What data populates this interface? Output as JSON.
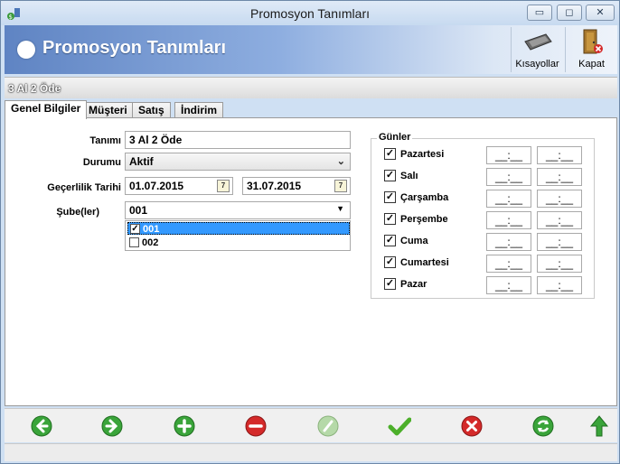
{
  "window": {
    "title": "Promosyon Tanımları",
    "minimize_glyph": "▭",
    "maximize_glyph": "◻",
    "close_glyph": "✕"
  },
  "banner": {
    "title": "Promosyon Tanımları",
    "shortcuts_label": "Kısayollar",
    "close_label": "Kapat"
  },
  "record_title": "3 Al 2 Öde",
  "tabs": [
    {
      "label": "Genel Bilgiler",
      "active": true
    },
    {
      "label": "Müşteri",
      "active": false
    },
    {
      "label": "Satış",
      "active": false
    },
    {
      "label": "İndirim",
      "active": false
    }
  ],
  "form": {
    "name_label": "Tanımı",
    "name_value": "3 Al 2 Öde",
    "status_label": "Durumu",
    "status_value": "Aktif",
    "validity_label": "Geçerlilik Tarihi",
    "date_start": "01.07.2015",
    "date_end": "31.07.2015",
    "calendar_glyph": "7",
    "branch_label": "Şube(ler)",
    "branch_value": "001",
    "branch_options": [
      {
        "label": "001",
        "checked": true,
        "selected": true
      },
      {
        "label": "002",
        "checked": false,
        "selected": false
      }
    ]
  },
  "days_group": {
    "title": "Günler",
    "time_placeholder": "__:__",
    "check_glyph": "✓",
    "days": [
      {
        "label": "Pazartesi",
        "checked": true
      },
      {
        "label": "Salı",
        "checked": true
      },
      {
        "label": "Çarşamba",
        "checked": true
      },
      {
        "label": "Perşembe",
        "checked": true
      },
      {
        "label": "Cuma",
        "checked": true
      },
      {
        "label": "Cumartesi",
        "checked": true
      },
      {
        "label": "Pazar",
        "checked": true
      }
    ]
  },
  "colors": {
    "nav_green": "#3aa43a",
    "nav_red": "#d42a2a",
    "check_green": "#4caf2a"
  },
  "bottom_toolbar": [
    "prev-arrow-icon",
    "next-arrow-icon",
    "add-icon",
    "delete-icon",
    "edit-icon",
    "confirm-icon",
    "cancel-icon",
    "refresh-icon",
    "up-arrow-icon"
  ]
}
